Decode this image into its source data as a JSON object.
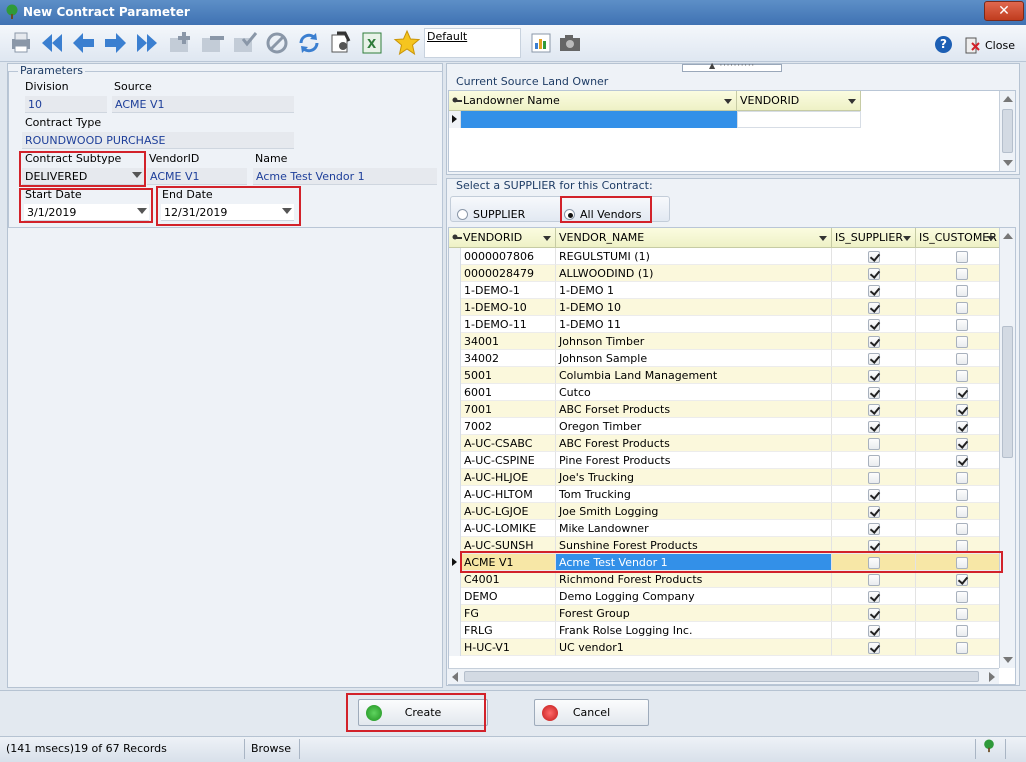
{
  "window": {
    "title": "New Contract Parameter",
    "close_glyph": "✕"
  },
  "toolbar": {
    "default_label": "Default",
    "help_glyph": "?",
    "close_label": "Close",
    "icons": [
      "print-icon",
      "first-icon",
      "prev-icon",
      "next-icon",
      "last-icon",
      "add-icon",
      "delete-icon",
      "post-icon",
      "cancel-edit-icon",
      "refresh-icon",
      "import-icon",
      "excel-icon",
      "favorite-star-icon",
      "report-icon",
      "camera-icon"
    ]
  },
  "parameters": {
    "legend": "Parameters",
    "division_label": "Division",
    "division_value": "10",
    "source_label": "Source",
    "source_value": "ACME V1",
    "contract_type_label": "Contract Type",
    "contract_type_value": "ROUNDWOOD PURCHASE",
    "subtype_label": "Contract Subtype",
    "subtype_value": "DELIVERED",
    "vendorid_label": "VendorID",
    "vendorid_value": "ACME V1",
    "name_label": "Name",
    "name_value": "Acme Test Vendor 1",
    "start_label": "Start Date",
    "start_value": "3/1/2019",
    "end_label": "End Date",
    "end_value": "12/31/2019"
  },
  "landowner": {
    "legend": "Current Source Land Owner",
    "col_name": "Landowner Name",
    "col_vendor": "VENDORID"
  },
  "supplier": {
    "legend": "Select a SUPPLIER for this Contract:",
    "radio_supplier": "SUPPLIER",
    "radio_all": "All Vendors",
    "columns": {
      "vendorid": "VENDORID",
      "vendor_name": "VENDOR_NAME",
      "is_supplier": "IS_SUPPLIER",
      "is_customer": "IS_CUSTOMER"
    },
    "rows": [
      {
        "id": "0000007806",
        "name": "REGULSTUMI (1)",
        "s": true,
        "c": false
      },
      {
        "id": "0000028479",
        "name": "ALLWOODIND (1)",
        "s": true,
        "c": false
      },
      {
        "id": "1-DEMO-1",
        "name": "1-DEMO 1",
        "s": true,
        "c": false
      },
      {
        "id": "1-DEMO-10",
        "name": "1-DEMO 10",
        "s": true,
        "c": false
      },
      {
        "id": "1-DEMO-11",
        "name": "1-DEMO 11",
        "s": true,
        "c": false
      },
      {
        "id": "34001",
        "name": "Johnson Timber",
        "s": true,
        "c": false
      },
      {
        "id": "34002",
        "name": "Johnson Sample",
        "s": true,
        "c": false
      },
      {
        "id": "5001",
        "name": "Columbia Land Management",
        "s": true,
        "c": false
      },
      {
        "id": "6001",
        "name": "Cutco",
        "s": true,
        "c": true
      },
      {
        "id": "7001",
        "name": "ABC Forset Products",
        "s": true,
        "c": true
      },
      {
        "id": "7002",
        "name": "Oregon Timber",
        "s": true,
        "c": true
      },
      {
        "id": "A-UC-CSABC",
        "name": "ABC Forest Products",
        "s": false,
        "c": true
      },
      {
        "id": "A-UC-CSPINE",
        "name": "Pine Forest Products",
        "s": false,
        "c": true
      },
      {
        "id": "A-UC-HLJOE",
        "name": "Joe's Trucking",
        "s": false,
        "c": false
      },
      {
        "id": "A-UC-HLTOM",
        "name": "Tom Trucking",
        "s": true,
        "c": false
      },
      {
        "id": "A-UC-LGJOE",
        "name": "Joe Smith Logging",
        "s": true,
        "c": false
      },
      {
        "id": "A-UC-LOMIKE",
        "name": "Mike Landowner",
        "s": true,
        "c": false
      },
      {
        "id": "A-UC-SUNSH",
        "name": "Sunshine Forest Products",
        "s": true,
        "c": false
      },
      {
        "id": "ACME V1",
        "name": "Acme Test Vendor 1",
        "s": false,
        "c": false,
        "selected": true
      },
      {
        "id": "C4001",
        "name": "Richmond Forest Products",
        "s": false,
        "c": true
      },
      {
        "id": "DEMO",
        "name": "Demo Logging Company",
        "s": true,
        "c": false
      },
      {
        "id": "FG",
        "name": "Forest Group",
        "s": true,
        "c": false
      },
      {
        "id": "FRLG",
        "name": "Frank Rolse Logging Inc.",
        "s": true,
        "c": false
      },
      {
        "id": "H-UC-V1",
        "name": "UC vendor1",
        "s": true,
        "c": false
      }
    ]
  },
  "buttons": {
    "create": "Create",
    "cancel": "Cancel"
  },
  "status": {
    "records": "(141 msecs)19 of 67 Records",
    "mode": "Browse"
  }
}
